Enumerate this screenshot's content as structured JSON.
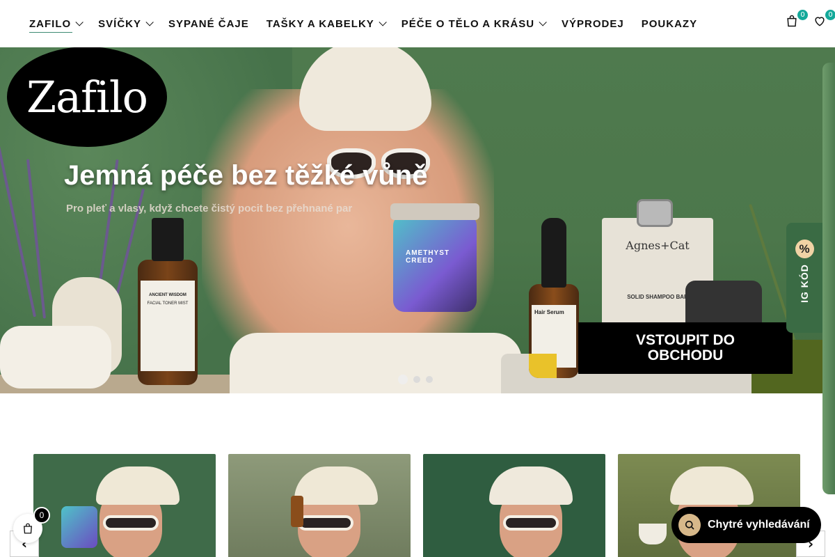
{
  "nav": {
    "items": [
      {
        "label": "ZAFILO",
        "has_dropdown": true,
        "active": true
      },
      {
        "label": "SVÍČKY",
        "has_dropdown": true
      },
      {
        "label": "SYPANÉ ČAJE",
        "has_dropdown": false
      },
      {
        "label": "TAŠKY A KABELKY",
        "has_dropdown": true
      },
      {
        "label": "PÉČE O TĚLO A KRÁSU",
        "has_dropdown": true
      },
      {
        "label": "VÝPRODEJ",
        "has_dropdown": false
      },
      {
        "label": "POUKAZY",
        "has_dropdown": false
      }
    ]
  },
  "header": {
    "cart_count": "0",
    "wishlist_count": "0",
    "cart_icon": "shopping-bag-icon",
    "wishlist_icon": "heart-icon"
  },
  "logo": {
    "text": "Zafilo"
  },
  "hero": {
    "title": "Jemná péče bez těžké vůně",
    "subtitle": "Pro pleť a vlasy, když chcete čistý pocit bez přehnané par",
    "cta_label": "VSTOUPIT DO OBCHODU",
    "slide_count": 3,
    "active_slide": 1,
    "product_labels": {
      "toner_brand": "ANCIENT WISDOM",
      "toner_name": "FACIAL TONER MIST",
      "jar_name": "AMETHYST CREED",
      "serum_name": "Hair Serum",
      "shampoo_brand": "Agnes+Cat",
      "shampoo_name": "SOLID SHAMPOO BAR"
    }
  },
  "promo": {
    "label": "IG KÓD",
    "icon": "percent"
  },
  "carousel": {
    "prev_label": "‹",
    "next_label": "›"
  },
  "floating_cart": {
    "count": "0"
  },
  "smart_search": {
    "label": "Chytré vyhledávání"
  },
  "colors": {
    "accent": "#14a99a",
    "promo_bg": "#3a6b44",
    "cta_bg": "#000000"
  }
}
